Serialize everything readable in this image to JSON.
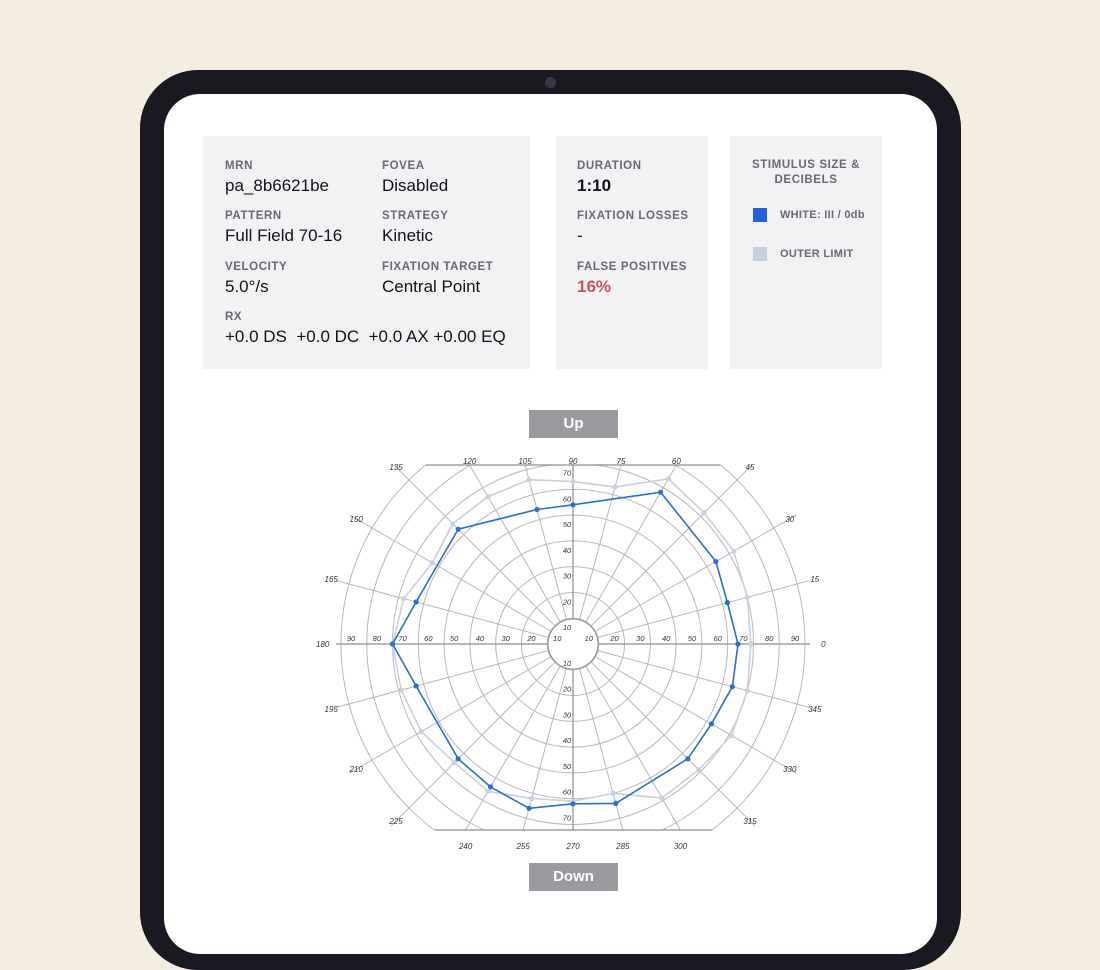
{
  "patient": {
    "mrn_label": "MRN",
    "mrn": "pa_8b6621be",
    "fovea_label": "FOVEA",
    "fovea": "Disabled",
    "pattern_label": "PATTERN",
    "pattern": "Full Field 70-16",
    "strategy_label": "STRATEGY",
    "strategy": "Kinetic",
    "velocity_label": "VELOCITY",
    "velocity": "5.0°/s",
    "fixation_target_label": "FIXATION TARGET",
    "fixation_target": "Central Point",
    "rx_label": "RX",
    "rx": "+0.0 DS  +0.0 DC  +0.0 AX +0.00 EQ"
  },
  "reliability": {
    "duration_label": "DURATION",
    "duration": "1:10",
    "fixation_losses_label": "FIXATION LOSSES",
    "fixation_losses": "-",
    "false_positives_label": "FALSE POSITIVES",
    "false_positives": "16%"
  },
  "legend": {
    "title_line1": "STIMULUS SIZE &",
    "title_line2": "DECIBELS",
    "items": [
      {
        "label": "WHITE: III / 0db",
        "color": "#2463e0"
      },
      {
        "label": "OUTER LIMIT",
        "color": "#c5cfe0"
      }
    ]
  },
  "controls": {
    "up_label": "Up",
    "down_label": "Down"
  },
  "colors": {
    "series": "#2a6dd8",
    "outer": "#c8d0dc",
    "false_positive": "#c9535c"
  },
  "chart_data": {
    "type": "polar",
    "angle_labels": [
      "0",
      "15",
      "30",
      "45",
      "60",
      "75",
      "90",
      "105",
      "120",
      "135",
      "150",
      "165",
      "180",
      "195",
      "210",
      "225",
      "240",
      "255",
      "270",
      "285",
      "300",
      "315",
      "330",
      "345"
    ],
    "radial_labels": [
      "10",
      "20",
      "30",
      "40",
      "50",
      "60",
      "70",
      "80",
      "90"
    ],
    "vertical_radial_labels": [
      "10",
      "20",
      "30",
      "40",
      "50",
      "60",
      "70"
    ],
    "rmax": 90,
    "grid": true,
    "series": [
      {
        "name": "WHITE: III / 0db",
        "points": [
          {
            "angle": 0,
            "r": 64
          },
          {
            "angle": 15,
            "r": 62
          },
          {
            "angle": 30,
            "r": 64
          },
          {
            "angle": 60,
            "r": 68
          },
          {
            "angle": 90,
            "r": 54
          },
          {
            "angle": 105,
            "r": 54
          },
          {
            "angle": 135,
            "r": 63
          },
          {
            "angle": 165,
            "r": 63
          },
          {
            "angle": 180,
            "r": 70
          },
          {
            "angle": 195,
            "r": 63
          },
          {
            "angle": 225,
            "r": 63
          },
          {
            "angle": 240,
            "r": 64
          },
          {
            "angle": 255,
            "r": 66
          },
          {
            "angle": 270,
            "r": 62
          },
          {
            "angle": 285,
            "r": 64
          },
          {
            "angle": 315,
            "r": 63
          },
          {
            "angle": 330,
            "r": 62
          },
          {
            "angle": 345,
            "r": 64
          }
        ]
      },
      {
        "name": "OUTER LIMIT",
        "points": [
          {
            "angle": 0,
            "r": 69
          },
          {
            "angle": 15,
            "r": 70
          },
          {
            "angle": 30,
            "r": 72
          },
          {
            "angle": 45,
            "r": 72
          },
          {
            "angle": 60,
            "r": 74
          },
          {
            "angle": 75,
            "r": 63
          },
          {
            "angle": 90,
            "r": 63
          },
          {
            "angle": 105,
            "r": 66
          },
          {
            "angle": 120,
            "r": 66
          },
          {
            "angle": 135,
            "r": 66
          },
          {
            "angle": 150,
            "r": 63
          },
          {
            "angle": 165,
            "r": 68
          },
          {
            "angle": 180,
            "r": 70
          },
          {
            "angle": 195,
            "r": 69
          },
          {
            "angle": 210,
            "r": 68
          },
          {
            "angle": 225,
            "r": 65
          },
          {
            "angle": 240,
            "r": 66
          },
          {
            "angle": 255,
            "r": 62
          },
          {
            "angle": 270,
            "r": 61
          },
          {
            "angle": 285,
            "r": 60
          },
          {
            "angle": 300,
            "r": 69
          },
          {
            "angle": 315,
            "r": 69
          },
          {
            "angle": 330,
            "r": 71
          },
          {
            "angle": 345,
            "r": 70
          }
        ]
      }
    ]
  }
}
